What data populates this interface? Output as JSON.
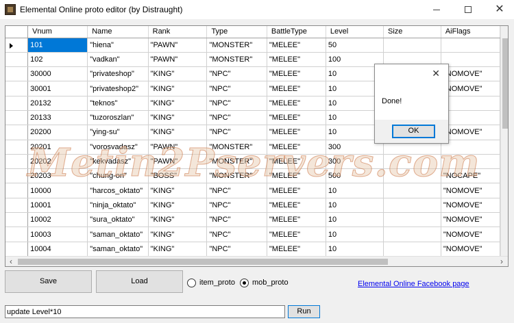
{
  "window": {
    "title": "Elemental Online proto editor (by Distraught)"
  },
  "table": {
    "columns": [
      "Vnum",
      "Name",
      "Rank",
      "Type",
      "BattleType",
      "Level",
      "Size",
      "AiFlags"
    ],
    "rows": [
      [
        "101",
        "\"hiena\"",
        "\"PAWN\"",
        "\"MONSTER\"",
        "\"MELEE\"",
        "50",
        "",
        ""
      ],
      [
        "102",
        "\"vadkan\"",
        "\"PAWN\"",
        "\"MONSTER\"",
        "\"MELEE\"",
        "100",
        "",
        ""
      ],
      [
        "30000",
        "\"privateshop\"",
        "\"KING\"",
        "\"NPC\"",
        "\"MELEE\"",
        "10",
        "",
        "\"NOMOVE\""
      ],
      [
        "30001",
        "\"privateshop2\"",
        "\"KING\"",
        "\"NPC\"",
        "\"MELEE\"",
        "10",
        "",
        "\"NOMOVE\""
      ],
      [
        "20132",
        "\"teknos\"",
        "\"KING\"",
        "\"NPC\"",
        "\"MELEE\"",
        "10",
        "",
        ""
      ],
      [
        "20133",
        "\"tuzoroszlan\"",
        "\"KING\"",
        "\"NPC\"",
        "\"MELEE\"",
        "10",
        "",
        ""
      ],
      [
        "20200",
        "\"ying-su\"",
        "\"KING\"",
        "\"NPC\"",
        "\"MELEE\"",
        "10",
        "",
        "\"NOMOVE\""
      ],
      [
        "20201",
        "\"vorosvadasz\"",
        "\"PAWN\"",
        "\"MONSTER\"",
        "\"MELEE\"",
        "300",
        "",
        ""
      ],
      [
        "20202",
        "\"kekvadasz\"",
        "\"PAWN\"",
        "\"MONSTER\"",
        "\"MELEE\"",
        "300",
        "",
        ""
      ],
      [
        "20203",
        "\"chung-on\"",
        "\"BOSS\"",
        "\"MONSTER\"",
        "\"MELEE\"",
        "500",
        "",
        "\"NOCAPE\""
      ],
      [
        "10000",
        "\"harcos_oktato\"",
        "\"KING\"",
        "\"NPC\"",
        "\"MELEE\"",
        "10",
        "",
        "\"NOMOVE\""
      ],
      [
        "10001",
        "\"ninja_oktato\"",
        "\"KING\"",
        "\"NPC\"",
        "\"MELEE\"",
        "10",
        "",
        "\"NOMOVE\""
      ],
      [
        "10002",
        "\"sura_oktato\"",
        "\"KING\"",
        "\"NPC\"",
        "\"MELEE\"",
        "10",
        "",
        "\"NOMOVE\""
      ],
      [
        "10003",
        "\"saman_oktato\"",
        "\"KING\"",
        "\"NPC\"",
        "\"MELEE\"",
        "10",
        "",
        "\"NOMOVE\""
      ],
      [
        "10004",
        "\"saman_oktato\"",
        "\"KING\"",
        "\"NPC\"",
        "\"MELEE\"",
        "10",
        "",
        "\"NOMOVE\""
      ]
    ],
    "selected_row": 0,
    "selected_column": 0
  },
  "dialog": {
    "message": "Done!",
    "ok_label": "OK",
    "close_glyph": "✕"
  },
  "controls": {
    "save_label": "Save",
    "load_label": "Load",
    "radio_item_label": "item_proto",
    "radio_mob_label": "mob_proto",
    "selected_radio": "mob_proto",
    "facebook_link": "Elemental Online Facebook page",
    "query_value": "update Level*10",
    "run_label": "Run"
  },
  "watermark": {
    "text": "Metin2Pservers.com"
  },
  "colors": {
    "selection": "#0078d7",
    "link": "#0000ee"
  }
}
